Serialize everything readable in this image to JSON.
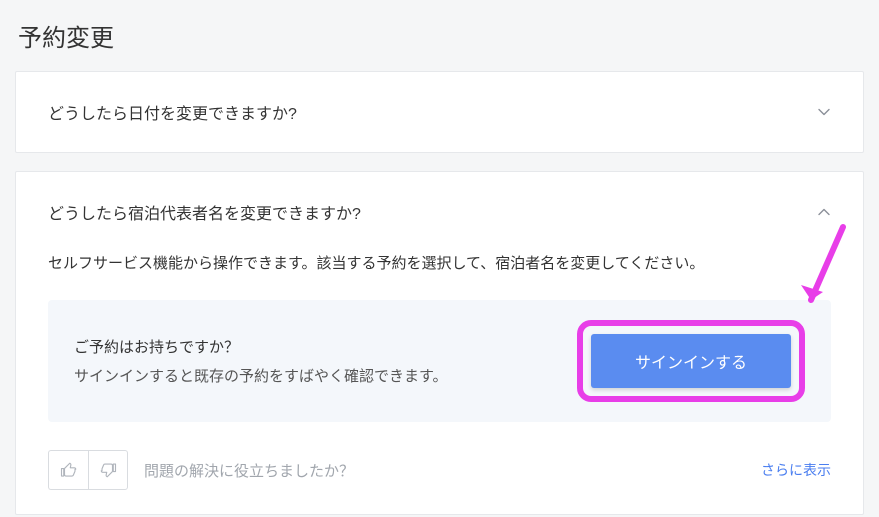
{
  "page_title": "予約変更",
  "accordion1": {
    "title": "どうしたら日付を変更できますか?"
  },
  "accordion2": {
    "title": "どうしたら宿泊代表者名を変更できますか?",
    "body": "セルフサービス機能から操作できます。該当する予約を選択して、宿泊者名を変更してください。",
    "signin": {
      "title": "ご予約はお持ちですか？",
      "sub": "サインインすると既存の予約をすばやく確認できます。",
      "button": "サインインする"
    },
    "feedback_text": "問題の解決に役立ちましたか？",
    "show_more": "さらに表示"
  }
}
